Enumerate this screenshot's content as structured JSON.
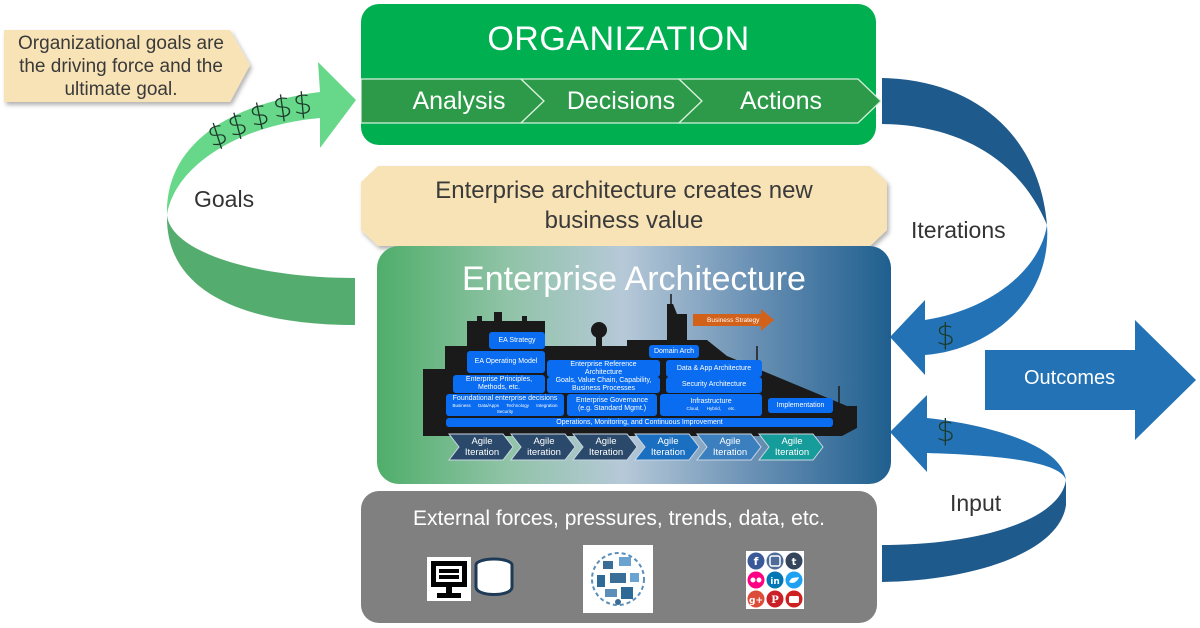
{
  "callouts": {
    "organizational_goals": [
      "Organizational goals are",
      "the driving force and the",
      "ultimate goal."
    ],
    "business_value": [
      "Enterprise architecture creates new",
      "business value"
    ]
  },
  "organization": {
    "title": "ORGANIZATION",
    "steps": [
      "Analysis",
      "Decisions",
      "Actions"
    ]
  },
  "loops": {
    "goals_label": "Goals",
    "goals_symbols": [
      "$",
      "$",
      "$",
      "$",
      "$"
    ],
    "iterations_label": "Iterations",
    "iterations_symbol": "$",
    "input_label": "Input",
    "input_symbol": "$",
    "outcomes_label": "Outcomes"
  },
  "enterprise_architecture": {
    "title": "Enterprise Architecture",
    "business_strategy": "Business Strategy",
    "blocks": {
      "ea_strategy": "EA Strategy",
      "ea_operating_model": "EA Operating Model",
      "domain_arch": "Domain Arch",
      "enterprise_reference_architecture": [
        "Enterprise Reference",
        "Architecture"
      ],
      "data_app_architecture": "Data & App Architecture",
      "enterprise_principles": [
        "Enterprise Principles,",
        "Methods, etc."
      ],
      "goals_value_chain": [
        "Goals, Value Chain, Capability,",
        "Business Processes"
      ],
      "security_architecture": "Security Architecture",
      "foundational_decisions": "Foundational enterprise decisions",
      "foundational_sub": [
        "Business",
        "Data/Apps",
        "Technology",
        "Integration",
        "Security"
      ],
      "enterprise_governance": [
        "Enterprise Governance",
        "(e.g. Standard Mgmt.)"
      ],
      "infrastructure": "Infrastructure",
      "infrastructure_sub": "Cloud, Hybrid, etc.",
      "implementation": "Implementation",
      "operations": "Operations, Monitoring, and Continuous Improvement"
    },
    "agile_iterations": [
      {
        "line1": "Agile",
        "line2": "Iteration",
        "color": "#2b4a6b"
      },
      {
        "line1": "Agile",
        "line2": "iteration",
        "color": "#2b4a6b"
      },
      {
        "line1": "Agile",
        "line2": "Iteration",
        "color": "#2b4a6b"
      },
      {
        "line1": "Agile",
        "line2": "Iteration",
        "color": "#1b6fc0"
      },
      {
        "line1": "Agile",
        "line2": "Iteration",
        "color": "#3b7fbf"
      },
      {
        "line1": "Agile",
        "line2": "Iteration",
        "color": "#169c9a"
      }
    ]
  },
  "external": {
    "title": "External forces, pressures, trends, data, etc.",
    "icons": [
      "computer-database-icon",
      "iot-devices-icon",
      "social-media-icon"
    ]
  },
  "colors": {
    "org_green": "#00b050",
    "goals_light_green": "#67d88a",
    "goals_dark_green": "#54ad6e",
    "loop_blue": "#2372b5",
    "loop_dark_blue": "#1e5a8c",
    "callout_fill": "#f8e3b6",
    "ext_gray": "#808080",
    "block_blue": "#0a6cf0",
    "strategy_orange": "#d2611a"
  }
}
